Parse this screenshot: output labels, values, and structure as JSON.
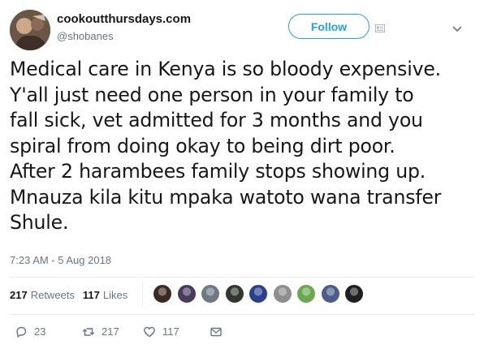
{
  "user": {
    "display_name": "cookoutthursdays.com",
    "handle": "@shobanes"
  },
  "follow_button": {
    "label": "Follow"
  },
  "tweet": {
    "lines": [
      "Medical care in Kenya is so bloody expensive.",
      "Y'all just need one person in your family to",
      "fall sick, vet admitted for 3 months and you",
      "spiral from doing okay to being dirt poor.",
      "After 2 harambees family stops showing up.",
      "Mnauza kila kitu mpaka watoto wana transfer",
      "Shule."
    ],
    "timestamp": "7:23 AM - 5 Aug 2018"
  },
  "stats": {
    "retweets_count": "217",
    "retweets_label": "Retweets",
    "likes_count": "117",
    "likes_label": "Likes"
  },
  "facepile": {
    "colors": [
      "#3b2a22",
      "#4a3b5c",
      "#6d7a83",
      "#2f3a2c",
      "#2a3f8f",
      "#8e8e8e",
      "#6aa84f",
      "#4d5d8a",
      "#1f1f1f"
    ]
  },
  "actions": {
    "reply_count": "23",
    "retweet_count": "217",
    "like_count": "117"
  },
  "colors": {
    "accent": "#1da1f2",
    "secondary_text": "#657786",
    "primary_text": "#14171a"
  },
  "icons": [
    "contact-card-icon",
    "chevron-down-icon",
    "reply-icon",
    "retweet-icon",
    "heart-icon",
    "envelope-icon"
  ]
}
